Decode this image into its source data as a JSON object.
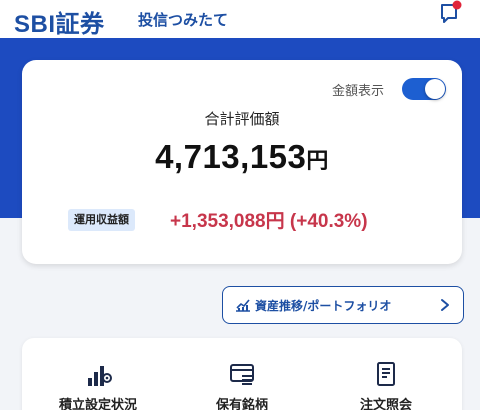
{
  "header": {
    "brand": "SBI証券",
    "subtitle": "投信つみたて",
    "message_icon": "message-bubble-icon",
    "notification_color": "#e0243a"
  },
  "colors": {
    "brand_blue": "#1d4fa3",
    "band_blue": "#1d4bc0",
    "profit_red": "#c7364b",
    "tag_bg": "#dce9fb"
  },
  "summary": {
    "toggle_label": "金額表示",
    "toggle_on": true,
    "total_label": "合計評価額",
    "total_value": "4,713,153",
    "total_unit": "円",
    "profit_label": "運用収益額",
    "profit_value": "+1,353,088円 (+40.3%)"
  },
  "trend_button": {
    "label": "資産推移/ポートフォリオ",
    "icon": "chart-icon",
    "chevron": "chevron-right-icon"
  },
  "menu": {
    "items": [
      {
        "label": "積立設定状況",
        "icon": "bar-chart-gear-icon"
      },
      {
        "label": "保有銘柄",
        "icon": "card-list-icon"
      },
      {
        "label": "注文照会",
        "icon": "document-icon"
      }
    ]
  }
}
